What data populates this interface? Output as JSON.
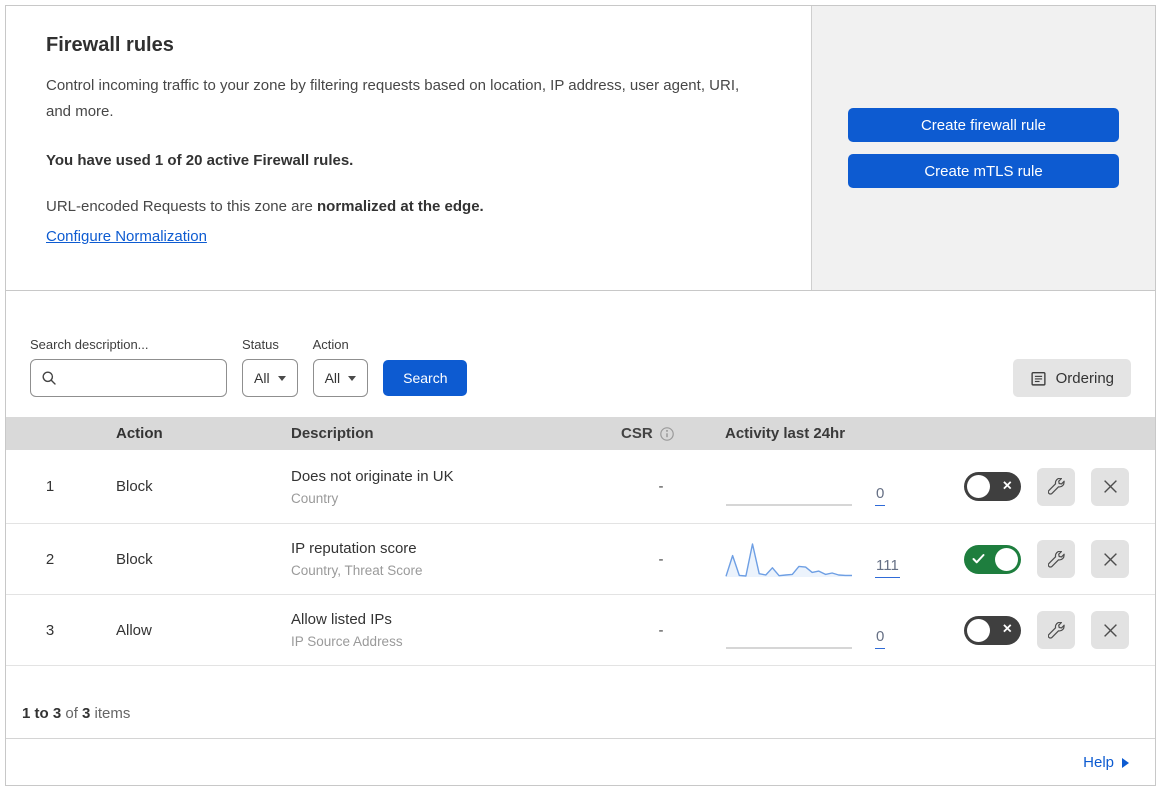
{
  "colors": {
    "accent_blue": "#0d5bd1",
    "link_blue": "#0d5bd1",
    "toggle_on_green": "#1e7e3e",
    "toggle_off_gray": "#3f3f3f",
    "header_band_gray": "#d9d9d9",
    "panel_gray": "#f1f1f1",
    "sparkline_blue": "#6e9fe4",
    "sparkline_flat_gray": "#bdbdbd"
  },
  "header": {
    "title": "Firewall rules",
    "description": "Control incoming traffic to your zone by filtering requests based on location, IP address, user agent, URI, and more.",
    "usage_line": "You have used 1 of 20 active Firewall rules.",
    "normalization_prefix": "URL-encoded Requests to this zone are ",
    "normalization_bold": "normalized at the edge.",
    "normalization_link": "Configure Normalization",
    "create_firewall_button": "Create firewall rule",
    "create_mtls_button": "Create mTLS rule"
  },
  "filters": {
    "search_label": "Search description...",
    "search_value": "",
    "status_label": "Status",
    "status_value": "All",
    "action_label": "Action",
    "action_value": "All",
    "search_button": "Search",
    "ordering_button": "Ordering"
  },
  "table": {
    "columns": {
      "action": "Action",
      "description": "Description",
      "csr": "CSR",
      "activity": "Activity last 24hr"
    },
    "rows": [
      {
        "index": "1",
        "action": "Block",
        "description": "Does not originate in UK",
        "criteria": "Country",
        "csr": "-",
        "count": "0",
        "enabled": false,
        "sparkline": [
          0,
          0,
          0,
          0,
          0,
          0,
          0,
          0,
          0,
          0,
          0,
          0,
          0,
          0,
          0,
          0,
          0,
          0,
          0,
          0
        ]
      },
      {
        "index": "2",
        "action": "Block",
        "description": "IP reputation score",
        "criteria": "Country, Threat Score",
        "csr": "-",
        "count": "111",
        "enabled": true,
        "sparkline": [
          2,
          65,
          5,
          3,
          100,
          10,
          6,
          28,
          4,
          6,
          8,
          32,
          30,
          14,
          18,
          8,
          12,
          6,
          5,
          5
        ]
      },
      {
        "index": "3",
        "action": "Allow",
        "description": "Allow listed IPs",
        "criteria": "IP Source Address",
        "csr": "-",
        "count": "0",
        "enabled": false,
        "sparkline": [
          0,
          0,
          0,
          0,
          0,
          0,
          0,
          0,
          0,
          0,
          0,
          0,
          0,
          0,
          0,
          0,
          0,
          0,
          0,
          0
        ]
      }
    ]
  },
  "footer": {
    "range_bold": "1 to 3",
    "of_text": " of ",
    "total_bold": "3",
    "items_text": " items",
    "help_label": "Help"
  }
}
